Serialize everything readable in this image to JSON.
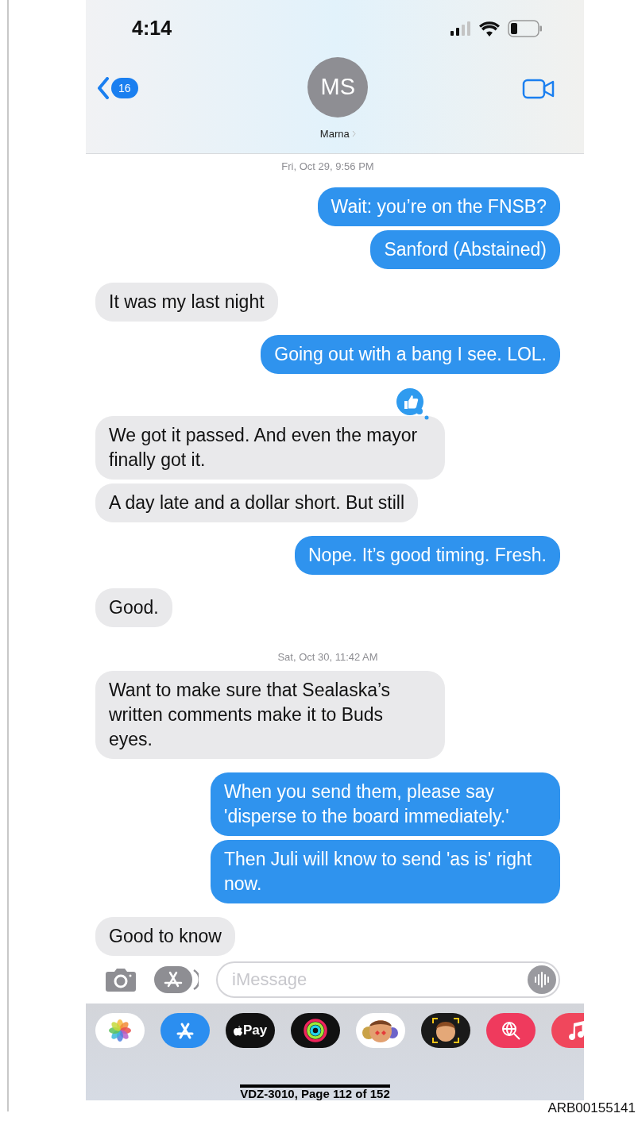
{
  "status_bar": {
    "time": "4:14"
  },
  "header": {
    "back_count": "16",
    "avatar_initials": "MS",
    "contact_name": "Marna"
  },
  "messages": [
    {
      "kind": "timestamp",
      "text": "Fri, Oct 29, 9:56 PM"
    },
    {
      "kind": "sent",
      "text": "Wait: you’re on the FNSB?",
      "reaction": false
    },
    {
      "kind": "sent",
      "text": "Sanford (Abstained)",
      "reaction": false
    },
    {
      "kind": "received",
      "text": "It was my last night",
      "reaction": false
    },
    {
      "kind": "sent",
      "text": "Going out with a bang I see. LOL.",
      "reaction": false
    },
    {
      "kind": "received",
      "text": "We got it passed. And even the mayor finally got it.",
      "reaction": true
    },
    {
      "kind": "received",
      "text": "A day late and a dollar short. But still",
      "reaction": false
    },
    {
      "kind": "sent",
      "text": "Nope. It’s good timing. Fresh.",
      "reaction": false
    },
    {
      "kind": "received",
      "text": "Good.",
      "reaction": false
    },
    {
      "kind": "timestamp",
      "text": "Sat, Oct 30, 11:42 AM"
    },
    {
      "kind": "received",
      "text": "Want to make sure that Sealaska’s written comments make it to Buds eyes.",
      "reaction": false
    },
    {
      "kind": "sent",
      "text": "When you send them, please say 'disperse to the board immediately.'",
      "reaction": false
    },
    {
      "kind": "sent",
      "text": "Then Juli will know to send 'as is' right now.",
      "reaction": false
    },
    {
      "kind": "received",
      "text": "Good to know",
      "reaction": false
    }
  ],
  "composer": {
    "placeholder": "iMessage"
  },
  "apps": [
    {
      "kind": "photos"
    },
    {
      "kind": "appstore"
    },
    {
      "kind": "pay",
      "label": "Pay"
    },
    {
      "kind": "activity"
    },
    {
      "kind": "memoji"
    },
    {
      "kind": "memoji_face"
    },
    {
      "kind": "image_search"
    },
    {
      "kind": "music"
    }
  ],
  "page_stamp": "VDZ-3010, Page 112 of 152",
  "bates_number": "ARB00155141"
}
